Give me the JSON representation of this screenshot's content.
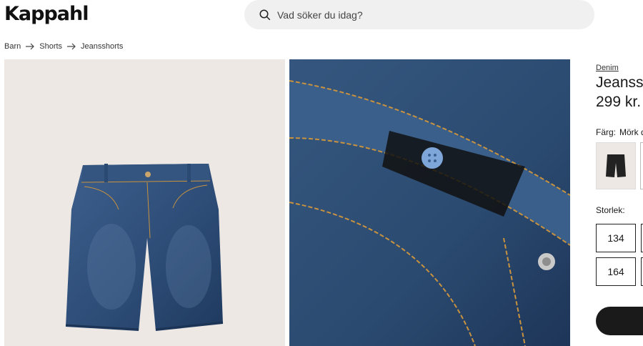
{
  "header": {
    "logo": "Kappahl",
    "search": {
      "placeholder": "Vad söker du idag?",
      "icon": "search-icon"
    }
  },
  "breadcrumb": [
    "Barn",
    "Shorts",
    "Jeansshorts"
  ],
  "gallery": {
    "images": [
      {
        "label": "product-photo-shorts-front",
        "background": "#ede8e3"
      },
      {
        "label": "product-photo-waist-detail",
        "background": "#2b4a70"
      }
    ]
  },
  "product": {
    "brand_link": "Denim",
    "name": "Jeansshorts",
    "price": "299 kr.",
    "color_label": "Färg:",
    "color_value": "Mörk denim",
    "size_label": "Storlek:",
    "sizes": [
      "134",
      "164"
    ]
  },
  "colors": {
    "accent": "#1a1a1a",
    "search_bg": "#f0f0f0",
    "denim": "#2f4f7a"
  }
}
